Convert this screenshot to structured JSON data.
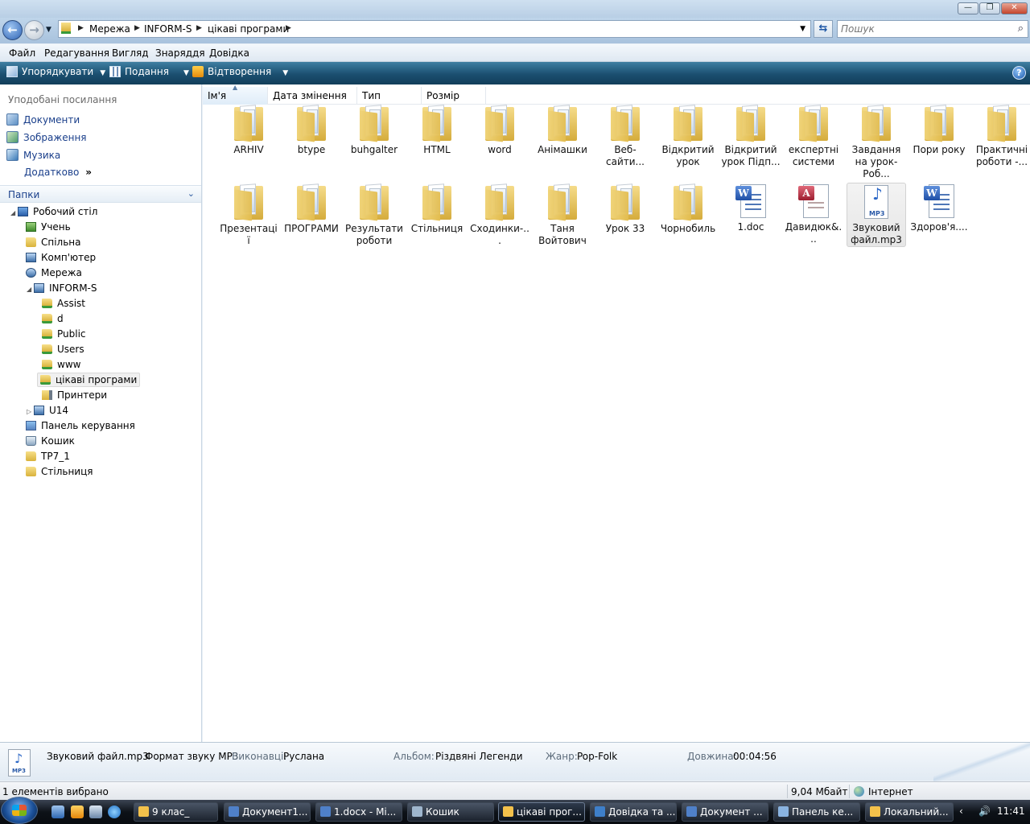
{
  "window": {
    "buttons": {
      "minimize": "—",
      "maximize": "❐",
      "close": "✕"
    }
  },
  "address": {
    "crumbs": [
      "Мережа",
      "INFORM-S",
      "цікаві програми"
    ]
  },
  "search": {
    "placeholder": "Пошук"
  },
  "menu": [
    "Файл",
    "Редагування",
    "Вигляд",
    "Знаряддя",
    "Довідка"
  ],
  "commands": {
    "organize": "Упорядкувати",
    "views": "Подання",
    "play": "Відтворення",
    "help": "?"
  },
  "nav": {
    "favorites_title": "Уподобані посилання",
    "favorites": [
      "Документи",
      "Зображення",
      "Музика",
      "Додатково"
    ],
    "more_glyph": "»",
    "folders_title": "Папки",
    "tree": [
      {
        "label": "Робочий стіл",
        "icon": "desktop-icon"
      },
      {
        "label": "Учень",
        "icon": "user-icon"
      },
      {
        "label": "Спільна",
        "icon": "folder-icon"
      },
      {
        "label": "Комп'ютер",
        "icon": "computer-icon"
      },
      {
        "label": "Мережа",
        "icon": "network-icon"
      },
      {
        "label": "INFORM-S",
        "icon": "server-icon"
      },
      {
        "label": "Assist",
        "icon": "netfolder-icon"
      },
      {
        "label": "d",
        "icon": "netfolder-icon"
      },
      {
        "label": "Public",
        "icon": "netfolder-icon"
      },
      {
        "label": "Users",
        "icon": "netfolder-icon"
      },
      {
        "label": "www",
        "icon": "netfolder-icon"
      },
      {
        "label": "цікаві програми",
        "icon": "netfolder-icon"
      },
      {
        "label": "Принтери",
        "icon": "printer-folder-icon"
      },
      {
        "label": "U14",
        "icon": "server-icon"
      },
      {
        "label": "Панель керування",
        "icon": "control-panel-icon"
      },
      {
        "label": "Кошик",
        "icon": "recycle-bin-icon"
      },
      {
        "label": "ТР7_1",
        "icon": "folder-icon"
      },
      {
        "label": "Стільниця",
        "icon": "folder-icon"
      }
    ]
  },
  "columns": [
    "Ім'я",
    "Дата змінення",
    "Тип",
    "Розмір"
  ],
  "items": [
    {
      "name": "ARHIV",
      "type": "folder"
    },
    {
      "name": "btype",
      "type": "folder"
    },
    {
      "name": "buhgalter",
      "type": "folder"
    },
    {
      "name": "HTML",
      "type": "folder"
    },
    {
      "name": "word",
      "type": "folder"
    },
    {
      "name": "Анімашки",
      "type": "folder"
    },
    {
      "name": "Веб-сайти...",
      "type": "folder"
    },
    {
      "name": "Відкритий урок",
      "type": "folder"
    },
    {
      "name": "Відкритий урок Підп...",
      "type": "folder"
    },
    {
      "name": "експертні системи",
      "type": "folder"
    },
    {
      "name": "Завдання на урок- Роб...",
      "type": "folder"
    },
    {
      "name": "Пори року",
      "type": "folder"
    },
    {
      "name": "Практичні роботи -...",
      "type": "folder"
    },
    {
      "name": "Презентації",
      "type": "folder"
    },
    {
      "name": "ПРОГРАМИ",
      "type": "folder"
    },
    {
      "name": "Результати роботи",
      "type": "folder"
    },
    {
      "name": "Стільниця",
      "type": "folder"
    },
    {
      "name": "Сходинки-...",
      "type": "folder"
    },
    {
      "name": "Таня Войтович",
      "type": "folder"
    },
    {
      "name": "Урок 33",
      "type": "folder"
    },
    {
      "name": "Чорнобиль",
      "type": "folder"
    },
    {
      "name": "1.doc",
      "type": "word"
    },
    {
      "name": "Давидюк&...",
      "type": "access"
    },
    {
      "name": "Звуковий файл.mp3",
      "type": "mp3",
      "selected": true
    },
    {
      "name": "Здоров'я....",
      "type": "word"
    }
  ],
  "icon_glyphs": {
    "word": "W",
    "access": "A",
    "mp3_note": "♪",
    "mp3_label": "MP3"
  },
  "details": {
    "filename": "Звуковий файл.mp3",
    "filetype": "Формат звуку MP3",
    "artist_label": "Виконавці:",
    "artist": "Руслана",
    "album_label": "Альбом:",
    "album": "Різдвяні Легенди",
    "genre_label": "Жанр:",
    "genre": "Pop-Folk",
    "length_label": "Довжина:",
    "length": "00:04:56"
  },
  "status": {
    "selected": "1 елементів вибрано",
    "size": "9,04 Мбайт",
    "zone": "Інтернет"
  },
  "taskbar": {
    "tasks": [
      "9 клас_",
      "Документ1...",
      "1.docx - Mi...",
      "Кошик",
      "цікаві прог...",
      "Довідка та ...",
      "Документ ...",
      "Панель ке...",
      "Локальний..."
    ],
    "active_index": 4,
    "clock": "11:41"
  },
  "colors": {
    "accent": "#1b4f70",
    "selection": "#e6e6e6",
    "link": "#1a3f8b"
  }
}
